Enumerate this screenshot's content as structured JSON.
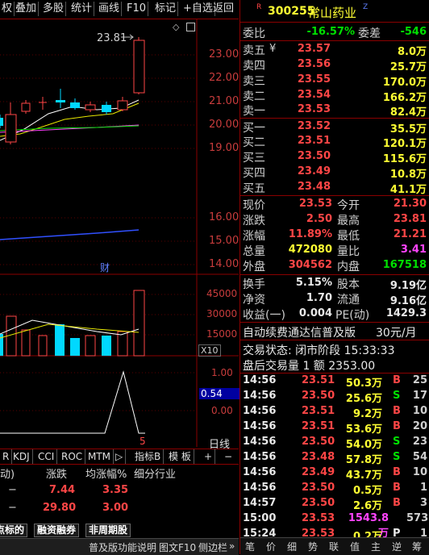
{
  "toolbar": {
    "items": [
      "权",
      "叠加",
      "多股",
      "统计",
      "画线",
      "F10",
      "标记",
      "+自选",
      "返回"
    ]
  },
  "chart": {
    "high_label": "23.81",
    "price_axis": [
      "23.00",
      "22.00",
      "21.00",
      "20.00",
      "19.00",
      "16.00",
      "15.00",
      "14.00"
    ],
    "fin_marker": "财",
    "volume_axis": [
      "45000",
      "30000",
      "15000"
    ],
    "volume_unit": "X10",
    "indicator_axis": [
      "1.00",
      "0.54",
      "0.00"
    ],
    "indicator_marker": "5",
    "daily_label": "日线"
  },
  "indicator_tabs": [
    "R",
    "KDJ",
    "CCI",
    "ROC",
    "MTM",
    "▷",
    "指标B",
    "模 板",
    "+",
    "−"
  ],
  "sector": {
    "headers": [
      "动)",
      "涨跌",
      "均涨幅%",
      "细分行业"
    ],
    "rows": [
      {
        "dash": "−",
        "change": "7.44",
        "avg": "3.35"
      },
      {
        "dash": "−",
        "change": "29.80",
        "avg": "3.00"
      }
    ]
  },
  "bottom_tabs": [
    "热点标的",
    "融资融券",
    "非周期股"
  ],
  "status": {
    "help": "普及版功能说明",
    "f10": "图文F10",
    "sidebar": "侧边栏",
    "more": "»"
  },
  "quote": {
    "badge_r": "R",
    "code": "300255",
    "name": "常山药业",
    "badge_z": "Z",
    "weibi_label": "委比",
    "weibi": "-16.57%",
    "weicha_label": "委差",
    "weicha": "-546",
    "sell": [
      {
        "label": "卖五",
        "flag": "¥",
        "price": "23.57",
        "vol": "8.0万"
      },
      {
        "label": "卖四",
        "flag": "",
        "price": "23.56",
        "vol": "25.7万"
      },
      {
        "label": "卖三",
        "flag": "",
        "price": "23.55",
        "vol": "170.0万"
      },
      {
        "label": "卖二",
        "flag": "",
        "price": "23.54",
        "vol": "166.2万"
      },
      {
        "label": "卖一",
        "flag": "",
        "price": "23.53",
        "vol": "82.4万"
      }
    ],
    "buy": [
      {
        "label": "买一",
        "price": "23.52",
        "vol": "35.5万"
      },
      {
        "label": "买二",
        "price": "23.51",
        "vol": "120.1万"
      },
      {
        "label": "买三",
        "price": "23.50",
        "vol": "115.6万"
      },
      {
        "label": "买四",
        "price": "23.49",
        "vol": "10.8万"
      },
      {
        "label": "买五",
        "price": "23.48",
        "vol": "41.1万"
      }
    ],
    "stats": [
      {
        "l1": "现价",
        "v1": "23.53",
        "c1": "red",
        "l2": "今开",
        "v2": "21.30",
        "c2": "red"
      },
      {
        "l1": "涨跌",
        "v1": "2.50",
        "c1": "red",
        "l2": "最高",
        "v2": "23.81",
        "c2": "red"
      },
      {
        "l1": "涨幅",
        "v1": "11.89%",
        "c1": "red",
        "l2": "最低",
        "v2": "21.21",
        "c2": "red"
      },
      {
        "l1": "总量",
        "v1": "472080",
        "c1": "yel",
        "l2": "量比",
        "v2": "3.41",
        "c2": "mag"
      },
      {
        "l1": "外盘",
        "v1": "304562",
        "c1": "red",
        "l2": "内盘",
        "v2": "167518",
        "c2": "grn"
      }
    ],
    "fund": [
      {
        "l1": "换手",
        "v1": "5.15%",
        "l2": "股本",
        "v2": "9.19亿"
      },
      {
        "l1": "净资",
        "v1": "1.70",
        "l2": "流通",
        "v2": "9.16亿"
      },
      {
        "l1": "收益(一)",
        "v1": "0.004",
        "l2": "PE(动)",
        "v2": "1429.3"
      }
    ],
    "promo": "自动续费通达信普及版",
    "promo_price": "30元/月",
    "trade_state": "交易状态: 闭市阶段 15:33:33",
    "after_hours": "盘后交易量 1 额 2353.00",
    "ticks": [
      {
        "t": "14:56",
        "p": "23.51",
        "v": "50.3万",
        "bs": "B",
        "n": "25"
      },
      {
        "t": "14:56",
        "p": "23.50",
        "v": "25.6万",
        "bs": "S",
        "n": "17"
      },
      {
        "t": "14:56",
        "p": "23.51",
        "v": "9.2万",
        "bs": "B",
        "n": "10"
      },
      {
        "t": "14:56",
        "p": "23.51",
        "v": "53.6万",
        "bs": "B",
        "n": "20"
      },
      {
        "t": "14:56",
        "p": "23.50",
        "v": "54.0万",
        "bs": "S",
        "n": "23"
      },
      {
        "t": "14:56",
        "p": "23.48",
        "v": "57.8万",
        "bs": "S",
        "n": "54"
      },
      {
        "t": "14:56",
        "p": "23.49",
        "v": "43.7万",
        "bs": "B",
        "n": "10"
      },
      {
        "t": "14:56",
        "p": "23.50",
        "v": "0.5万",
        "bs": "B",
        "n": "1"
      },
      {
        "t": "14:57",
        "p": "23.50",
        "v": "2.6万",
        "bs": "B",
        "n": "3"
      },
      {
        "t": "15:00",
        "p": "23.53",
        "v": "1543.8万",
        "bs": "",
        "n": "573"
      },
      {
        "t": "15:24",
        "p": "23.53",
        "v": "0.2万",
        "bs": "P",
        "n": "1"
      }
    ],
    "tabs": [
      "笔",
      "价",
      "细",
      "势",
      "联",
      "值",
      "主",
      "逆",
      "筹"
    ]
  }
}
